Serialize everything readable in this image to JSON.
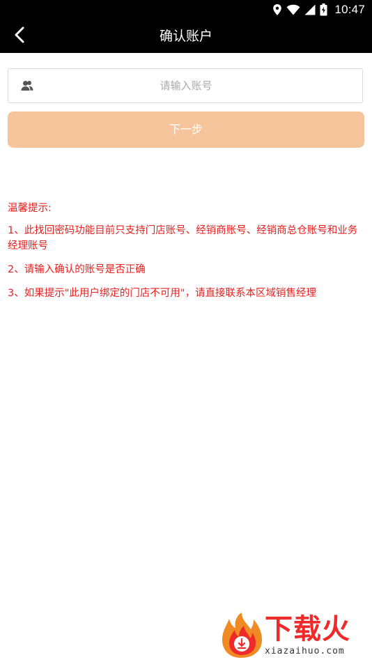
{
  "status_bar": {
    "time": "10:47",
    "icons": [
      "location-icon",
      "wifi-icon",
      "signal-icon",
      "battery-icon"
    ]
  },
  "toolbar": {
    "title": "确认账户",
    "back_icon": "chevron-left-icon"
  },
  "account": {
    "placeholder": "请输入账号",
    "value": "",
    "icon": "user-group-icon"
  },
  "next_button": {
    "label": "下一步"
  },
  "tips": {
    "title": "温馨提示:",
    "items": [
      "1、此找回密码功能目前只支持门店账号、经销商账号、经销商总仓账号和业务经理账号",
      "2、请输入确认的账号是否正确",
      "3、如果提示\"此用户绑定的门店不可用\"，请直接联系本区域销售经理"
    ]
  },
  "watermark": {
    "brand": "下载火",
    "url": "xiazaihuo.com"
  },
  "colors": {
    "toolbar_bg": "#000000",
    "button_bg": "#f6c49b",
    "tip_text": "#e82020",
    "watermark_red": "#ee2a2a"
  }
}
